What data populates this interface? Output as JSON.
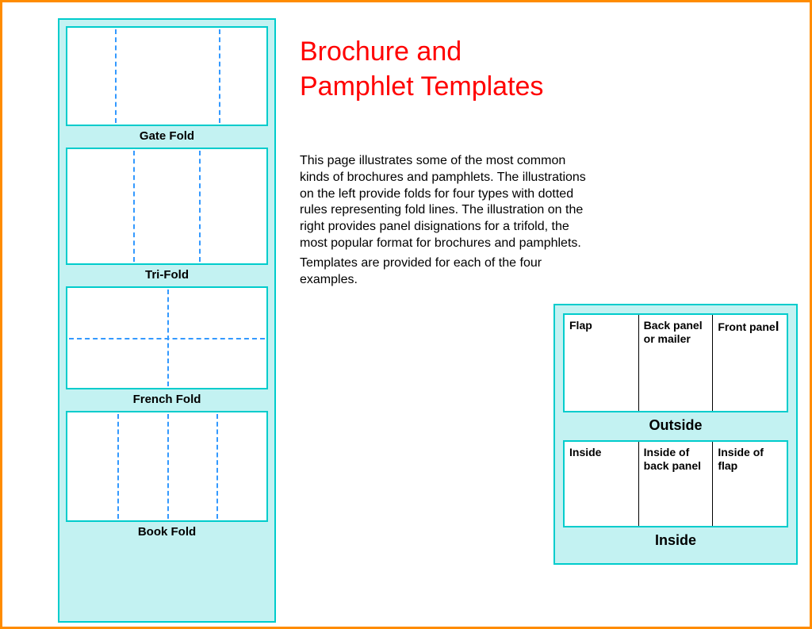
{
  "title": {
    "line1": "Brochure and",
    "line2": "Pamphlet Templates"
  },
  "description": {
    "para1": "This page illustrates some of the most common kinds of brochures and pamphlets. The illustrations on the left provide folds for four types with dotted rules representing fold lines. The illustration on the right provides panel disignations for a trifold, the most popular format for brochures and pamphlets.",
    "para2": "Templates are provided for each of the four examples."
  },
  "folds": {
    "gate": "Gate Fold",
    "tri": "Tri-Fold",
    "french": "French Fold",
    "book": "Book Fold"
  },
  "trifold": {
    "outside": {
      "label": "Outside",
      "flap": "Flap",
      "back": "Back panel or mailer",
      "front": "Front pane",
      "front_l": "l"
    },
    "inside": {
      "label": "Inside",
      "p1": "Inside",
      "p2": "Inside of back panel",
      "p3": "Inside of flap"
    }
  }
}
